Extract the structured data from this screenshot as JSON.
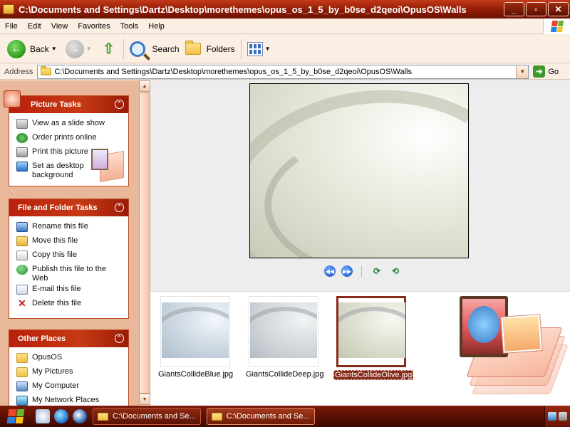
{
  "window": {
    "title": "C:\\Documents and Settings\\Dartz\\Desktop\\morethemes\\opus_os_1_5_by_b0se_d2qeoi\\OpusOS\\Walls",
    "minimize": "_",
    "maximize": "▫",
    "close": "✕"
  },
  "menubar": [
    "File",
    "Edit",
    "View",
    "Favorites",
    "Tools",
    "Help"
  ],
  "toolbar": {
    "back_label": "Back",
    "search_label": "Search",
    "folders_label": "Folders"
  },
  "address": {
    "label": "Address",
    "value": "C:\\Documents and Settings\\Dartz\\Desktop\\morethemes\\opus_os_1_5_by_b0se_d2qeoi\\OpusOS\\Walls",
    "go_label": "Go"
  },
  "picture_tasks": {
    "title": "Picture Tasks",
    "items": [
      "View as a slide show",
      "Order prints online",
      "Print this picture",
      "Set as desktop background"
    ]
  },
  "file_tasks": {
    "title": "File and Folder Tasks",
    "items": [
      "Rename this file",
      "Move this file",
      "Copy this file",
      "Publish this file to the Web",
      "E-mail this file",
      "Delete this file"
    ]
  },
  "other_places": {
    "title": "Other Places",
    "items": [
      "OpusOS",
      "My Pictures",
      "My Computer",
      "My Network Places"
    ]
  },
  "thumbnails": [
    {
      "name": "GiantsCollideBlue.jpg",
      "selected": false
    },
    {
      "name": "GiantsCollideDeep.jpg",
      "selected": false
    },
    {
      "name": "GiantsCollideOlive.jpg",
      "selected": true
    }
  ],
  "taskbar": {
    "buttons": [
      "C:\\Documents and Se...",
      "C:\\Documents and Se..."
    ]
  },
  "colors": {
    "title_bar": "#8e1b05",
    "panel_header": "#b8200a",
    "selection": "#8a2a1a"
  }
}
